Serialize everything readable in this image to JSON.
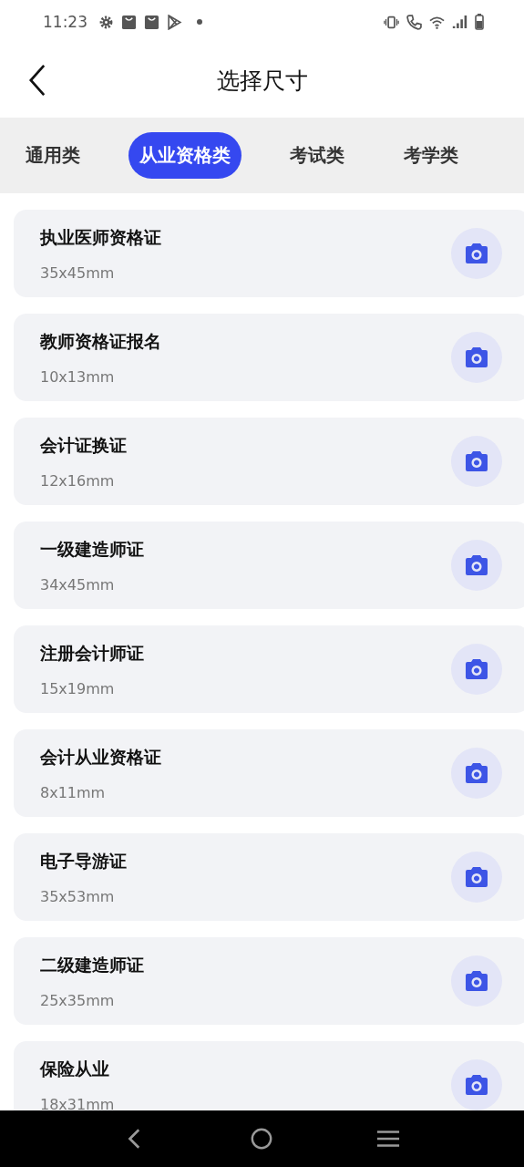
{
  "status_bar": {
    "time": "11:23"
  },
  "header": {
    "title": "选择尺寸"
  },
  "tabs": [
    {
      "label": "通用类",
      "selected": false
    },
    {
      "label": "从业资格类",
      "selected": true
    },
    {
      "label": "考试类",
      "selected": false
    },
    {
      "label": "考学类",
      "selected": false
    }
  ],
  "items": [
    {
      "name": "执业医师资格证",
      "size": "35x45mm"
    },
    {
      "name": "教师资格证报名",
      "size": "10x13mm"
    },
    {
      "name": "会计证换证",
      "size": "12x16mm"
    },
    {
      "name": "一级建造师证",
      "size": "34x45mm"
    },
    {
      "name": "注册会计师证",
      "size": "15x19mm"
    },
    {
      "name": "会计从业资格证",
      "size": "8x11mm"
    },
    {
      "name": "电子导游证",
      "size": "35x53mm"
    },
    {
      "name": "二级建造师证",
      "size": "25x35mm"
    },
    {
      "name": "保险从业",
      "size": "18x31mm"
    }
  ]
}
